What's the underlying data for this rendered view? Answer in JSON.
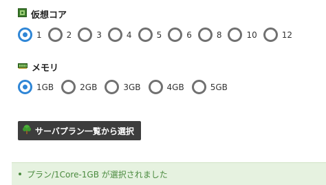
{
  "cpu": {
    "title": "仮想コア",
    "icon": "cpu-chip-icon",
    "selected": "1",
    "options": [
      "1",
      "2",
      "3",
      "4",
      "5",
      "6",
      "8",
      "10",
      "12"
    ]
  },
  "memory": {
    "title": "メモリ",
    "icon": "memory-module-icon",
    "selected": "1GB",
    "options": [
      "1GB",
      "2GB",
      "3GB",
      "4GB",
      "5GB"
    ]
  },
  "plan_button": {
    "label": "サーバプラン一覧から選択",
    "icon": "tree-icon"
  },
  "message": {
    "text": "プラン/1Core-1GB が選択されました"
  },
  "colors": {
    "radio_selected": "#2f86d6",
    "radio_unselected": "#707070",
    "button_bg": "#3d3d3d",
    "message_bg": "#e6f2e0",
    "message_text": "#4a8a3e"
  }
}
